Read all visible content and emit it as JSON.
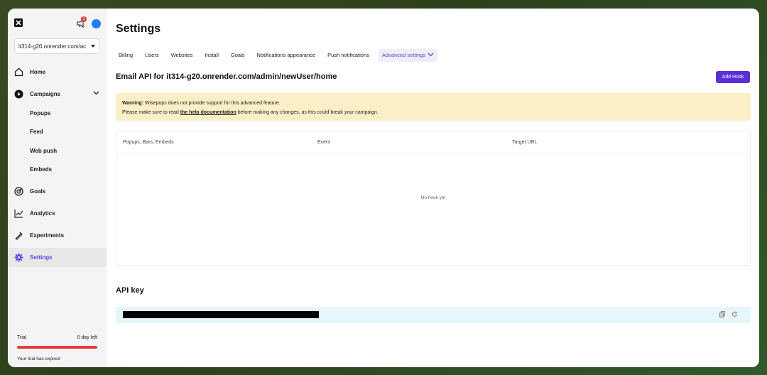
{
  "sidebar": {
    "site_select_value": "it314-g20.onrender.com/ac",
    "notification_count": "1",
    "items": [
      {
        "label": "Home",
        "icon": "home-icon"
      },
      {
        "label": "Campaigns",
        "icon": "play-circle-icon"
      },
      {
        "label": "Popups"
      },
      {
        "label": "Feed"
      },
      {
        "label": "Web push"
      },
      {
        "label": "Embeds"
      },
      {
        "label": "Goals",
        "icon": "target-icon"
      },
      {
        "label": "Analytics",
        "icon": "chart-line-icon"
      },
      {
        "label": "Experiments",
        "icon": "flask-icon"
      },
      {
        "label": "Settings",
        "icon": "gear-icon"
      }
    ],
    "trial": {
      "label": "Trial",
      "days_left": "0 day left",
      "expired_text": "Your trial has expired"
    }
  },
  "main": {
    "title": "Settings",
    "tabs": [
      "Billing",
      "Users",
      "Websites",
      "Install",
      "Goals",
      "Notifications appearance",
      "Push notifications",
      "Advanced settings"
    ],
    "section_title": "Email API for it314-g20.onrender.com/admin/newUser/home",
    "add_hook_label": "Add Hook",
    "warning": {
      "strong": "Warning:",
      "line1": " Wisepops does not provide support for this advanced feature.",
      "line2_pre": "Please make sure to read ",
      "link": "the help documentation",
      "line2_post": " before making any changes, as this could break your campaign."
    },
    "table": {
      "columns": [
        "Popups, Bars, Embeds",
        "Event",
        "Target URL"
      ],
      "empty_text": "No hook yet"
    },
    "api_key_title": "API key"
  },
  "colors": {
    "accent": "#6a3de8",
    "button": "#5b2fd6",
    "warning_bg": "#fbefc8",
    "api_row_bg": "#e6f6fa",
    "trial_bar": "#e43d3d",
    "avatar": "#1f7ef0"
  }
}
